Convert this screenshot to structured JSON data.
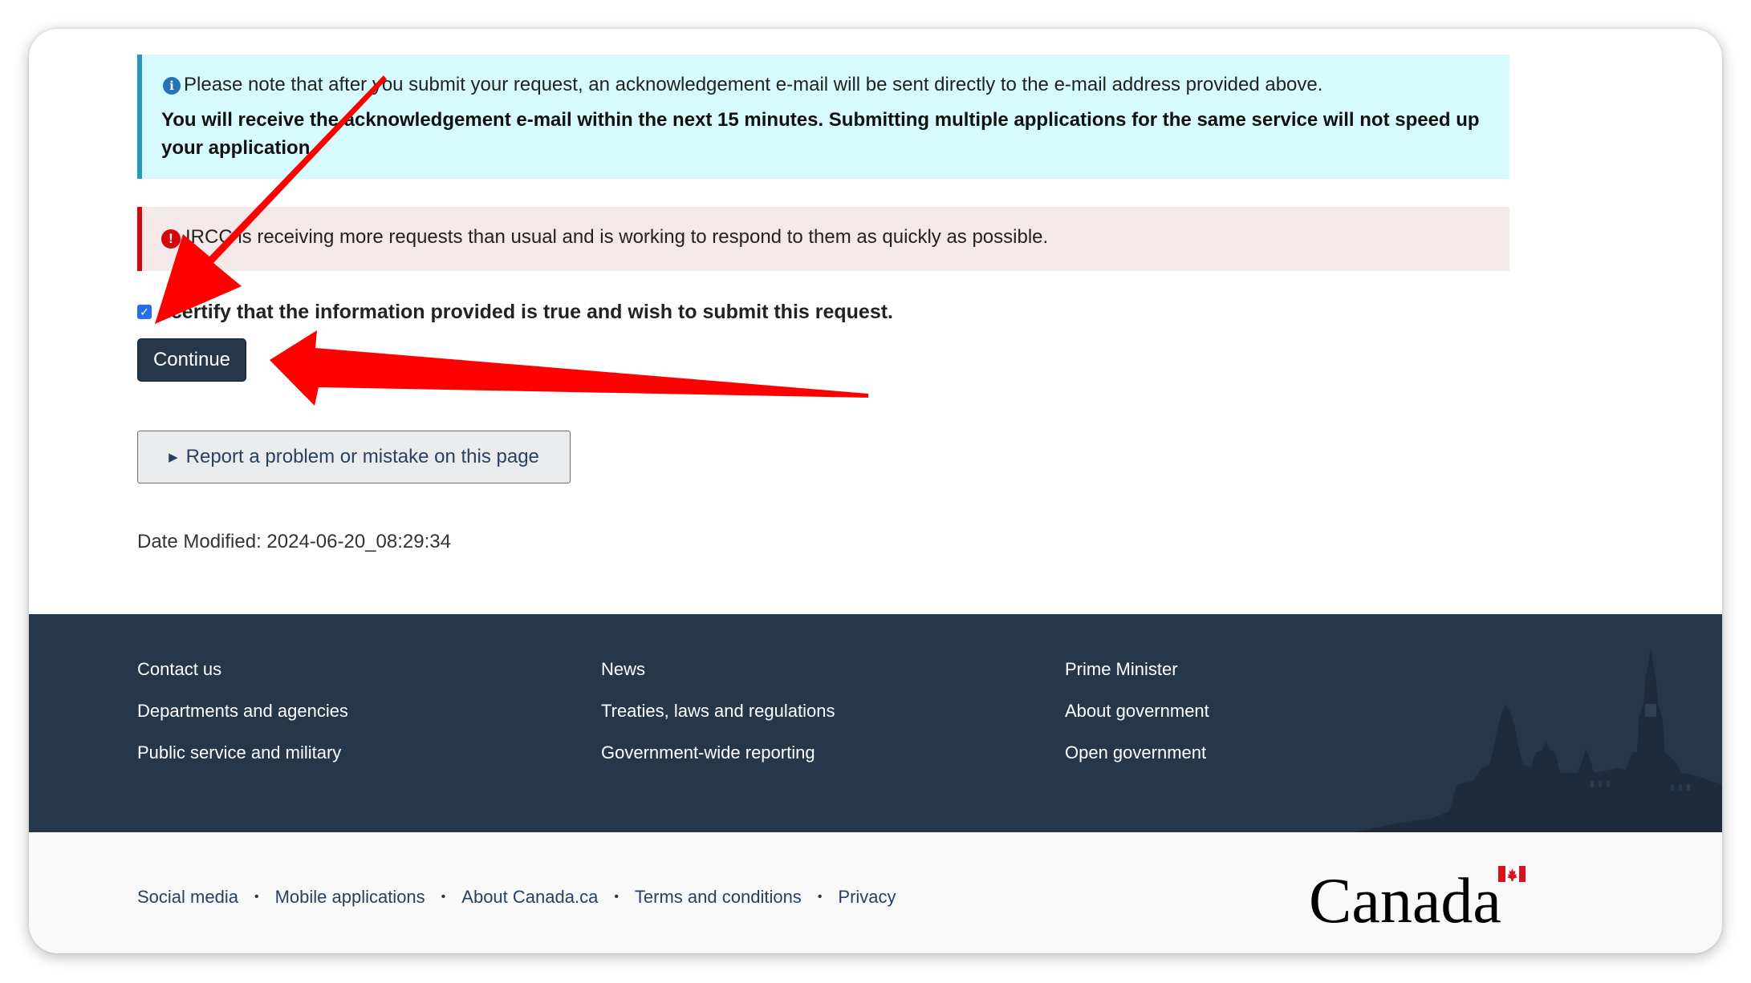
{
  "info_alert": {
    "icon": "info-icon",
    "line1": "Please note that after you submit your request, an acknowledgement e-mail will be sent directly to the e-mail address provided above.",
    "line2": "You will receive the acknowledgement e-mail within the next 15 minutes. Submitting multiple applications for the same service will not speed up your application."
  },
  "warning_alert": {
    "icon": "exclamation-icon",
    "text": "IRCC is receiving more requests than usual and is working to respond to them as quickly as possible."
  },
  "certify": {
    "checked": true,
    "label": "I certify that the information provided is true and wish to submit this request."
  },
  "continue_label": "Continue",
  "report_label": "Report a problem or mistake on this page",
  "date_modified": "Date Modified: 2024-06-20_08:29:34",
  "footer": {
    "col1": [
      "Contact us",
      "Departments and agencies",
      "Public service and military"
    ],
    "col2": [
      "News",
      "Treaties, laws and regulations",
      "Government-wide reporting"
    ],
    "col3": [
      "Prime Minister",
      "About government",
      "Open government"
    ]
  },
  "sub_footer": {
    "links": [
      "Social media",
      "Mobile applications",
      "About Canada.ca",
      "Terms and conditions",
      "Privacy"
    ],
    "wordmark": "Canada"
  },
  "colors": {
    "primary": "#26374a",
    "info_bg": "#d7faff",
    "warn_bg": "#f3e9e8",
    "annotation_arrow": "#ff0000"
  }
}
